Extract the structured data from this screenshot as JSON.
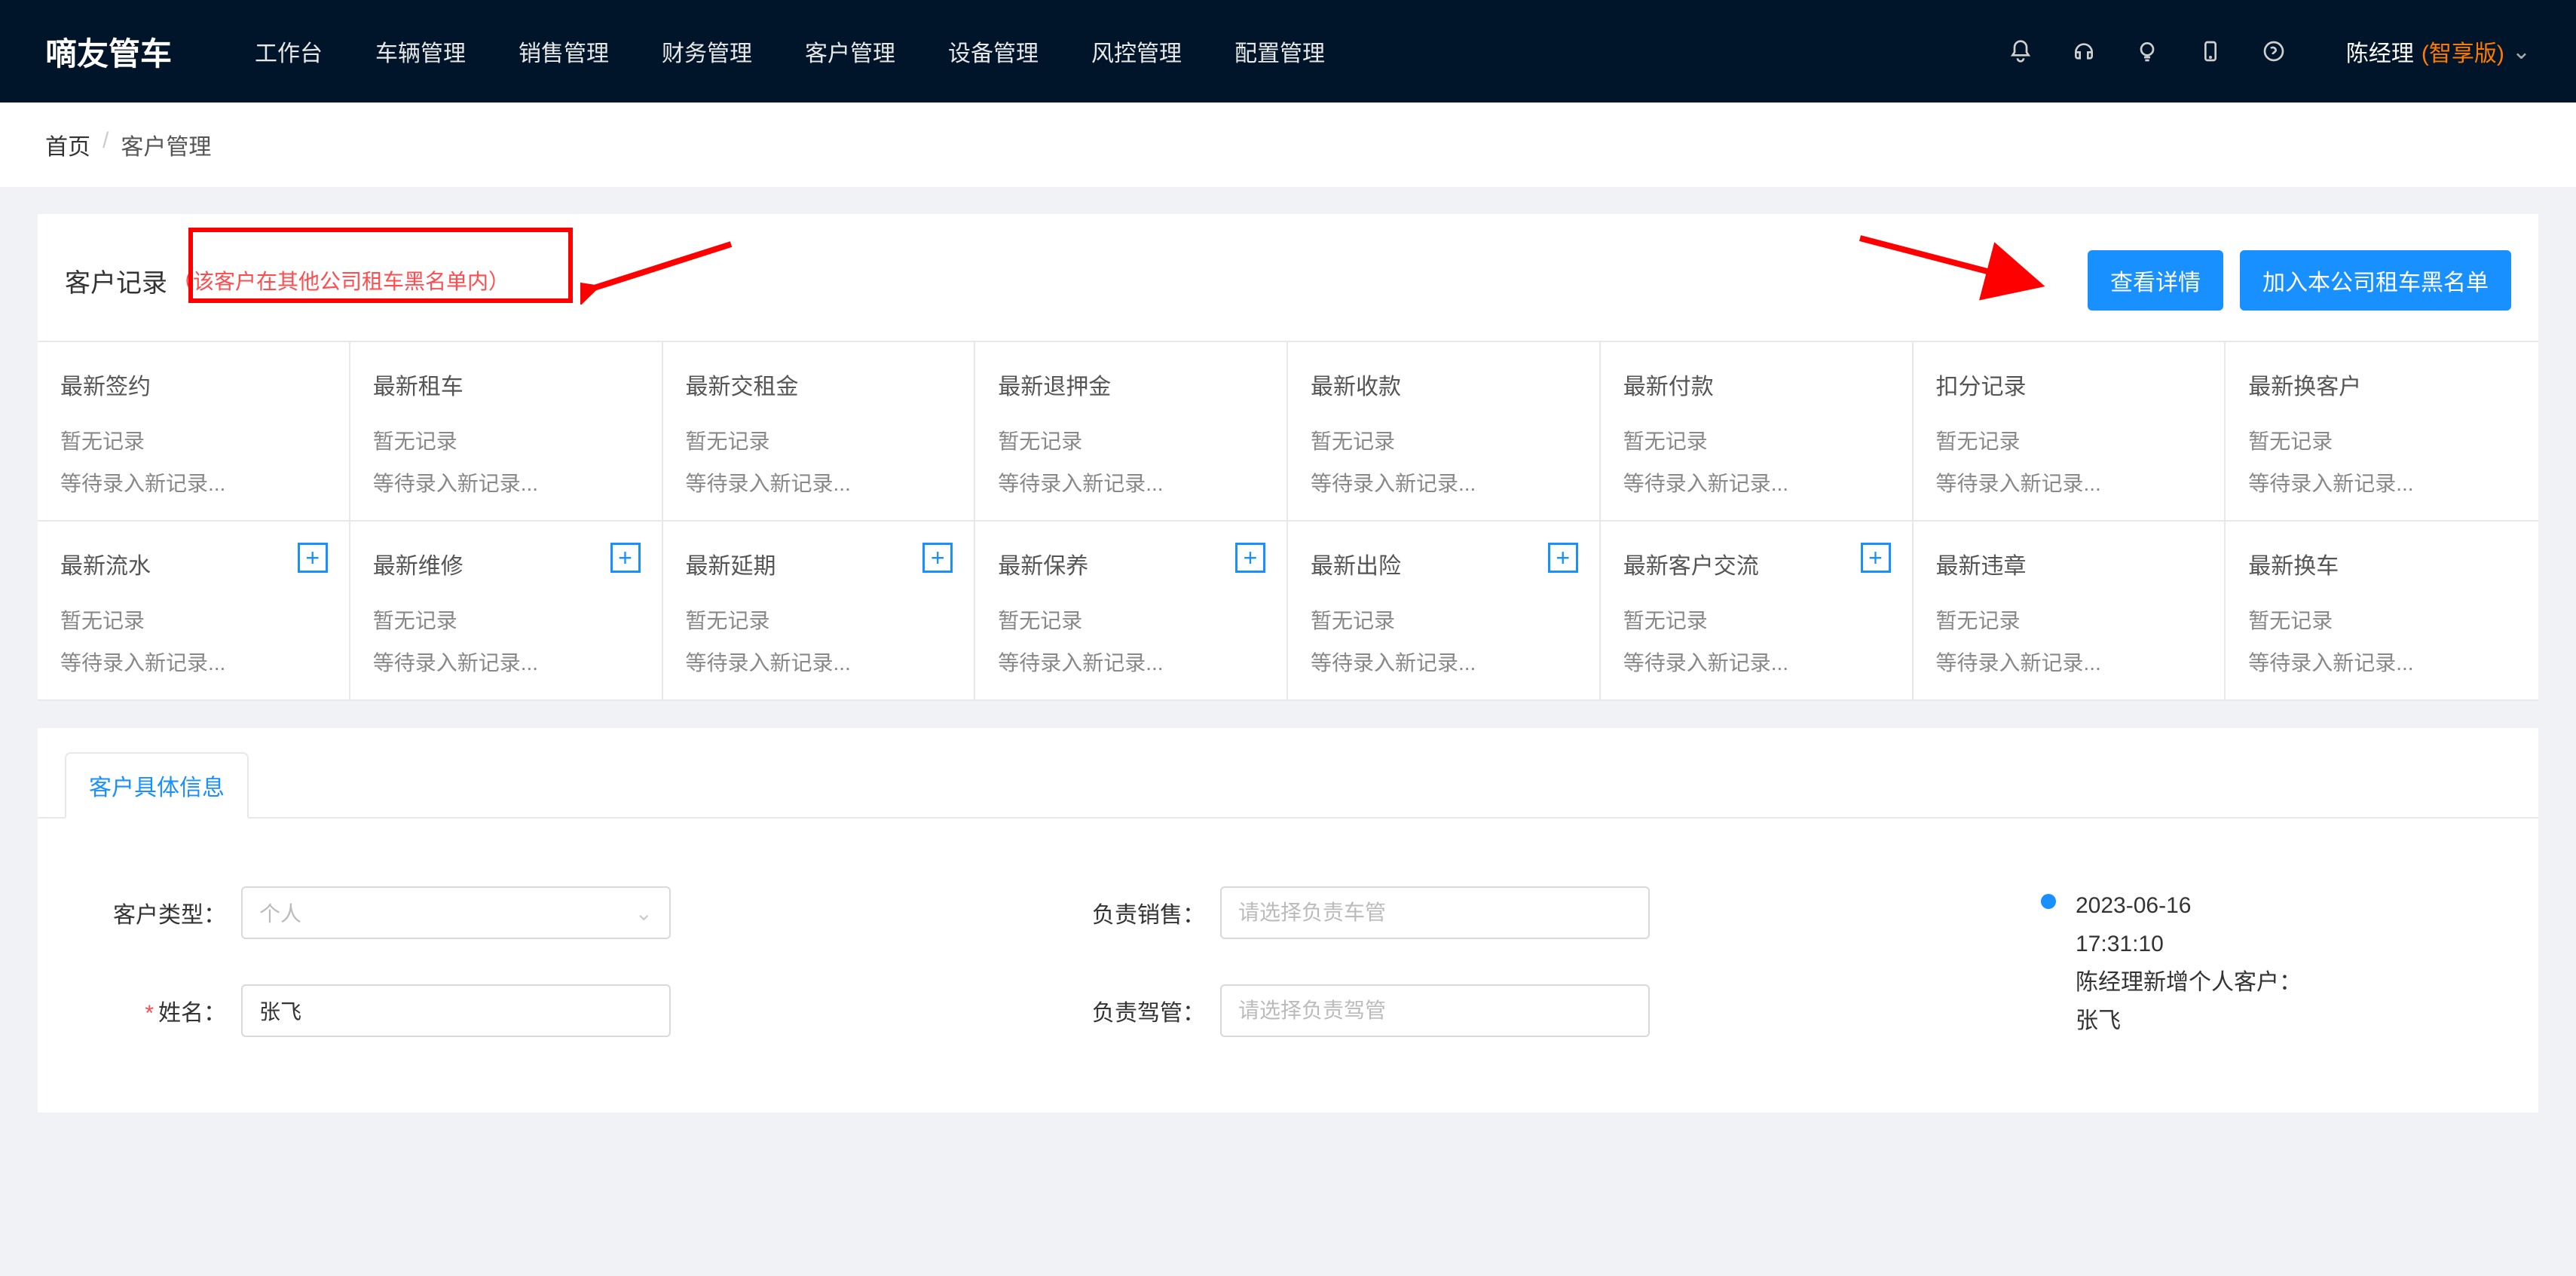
{
  "brand": "嘀友管车",
  "nav": [
    "工作台",
    "车辆管理",
    "销售管理",
    "财务管理",
    "客户管理",
    "设备管理",
    "风控管理",
    "配置管理"
  ],
  "user": {
    "name": "陈经理",
    "version": "(智享版)"
  },
  "crumb": {
    "home": "首页",
    "sep": "/",
    "cur": "客户管理"
  },
  "records": {
    "title": "客户记录",
    "note": "（该客户在其他公司租车黑名单内）",
    "btn_detail": "查看详情",
    "btn_blacklist": "加入本公司租车黑名单",
    "row1": [
      {
        "t": "最新签约"
      },
      {
        "t": "最新租车"
      },
      {
        "t": "最新交租金"
      },
      {
        "t": "最新退押金"
      },
      {
        "t": "最新收款"
      },
      {
        "t": "最新付款"
      },
      {
        "t": "扣分记录"
      },
      {
        "t": "最新换客户"
      }
    ],
    "row2": [
      {
        "t": "最新流水",
        "plus": true
      },
      {
        "t": "最新维修",
        "plus": true
      },
      {
        "t": "最新延期",
        "plus": true
      },
      {
        "t": "最新保养",
        "plus": true
      },
      {
        "t": "最新出险",
        "plus": true
      },
      {
        "t": "最新客户交流",
        "plus": true
      },
      {
        "t": "最新违章"
      },
      {
        "t": "最新换车"
      }
    ],
    "empty": "暂无记录",
    "wait": "等待录入新记录..."
  },
  "tab": "客户具体信息",
  "form": {
    "type_label": "客户类型：",
    "type_value": "个人",
    "name_label": "姓名：",
    "name_value": "张飞",
    "sales_label": "负责销售：",
    "sales_ph": "请选择负责车管",
    "driver_label": "负责驾管：",
    "driver_ph": "请选择负责驾管"
  },
  "timeline": {
    "date": "2023-06-16",
    "time": "17:31:10",
    "line1": "陈经理新增个人客户：",
    "line2": "张飞"
  }
}
